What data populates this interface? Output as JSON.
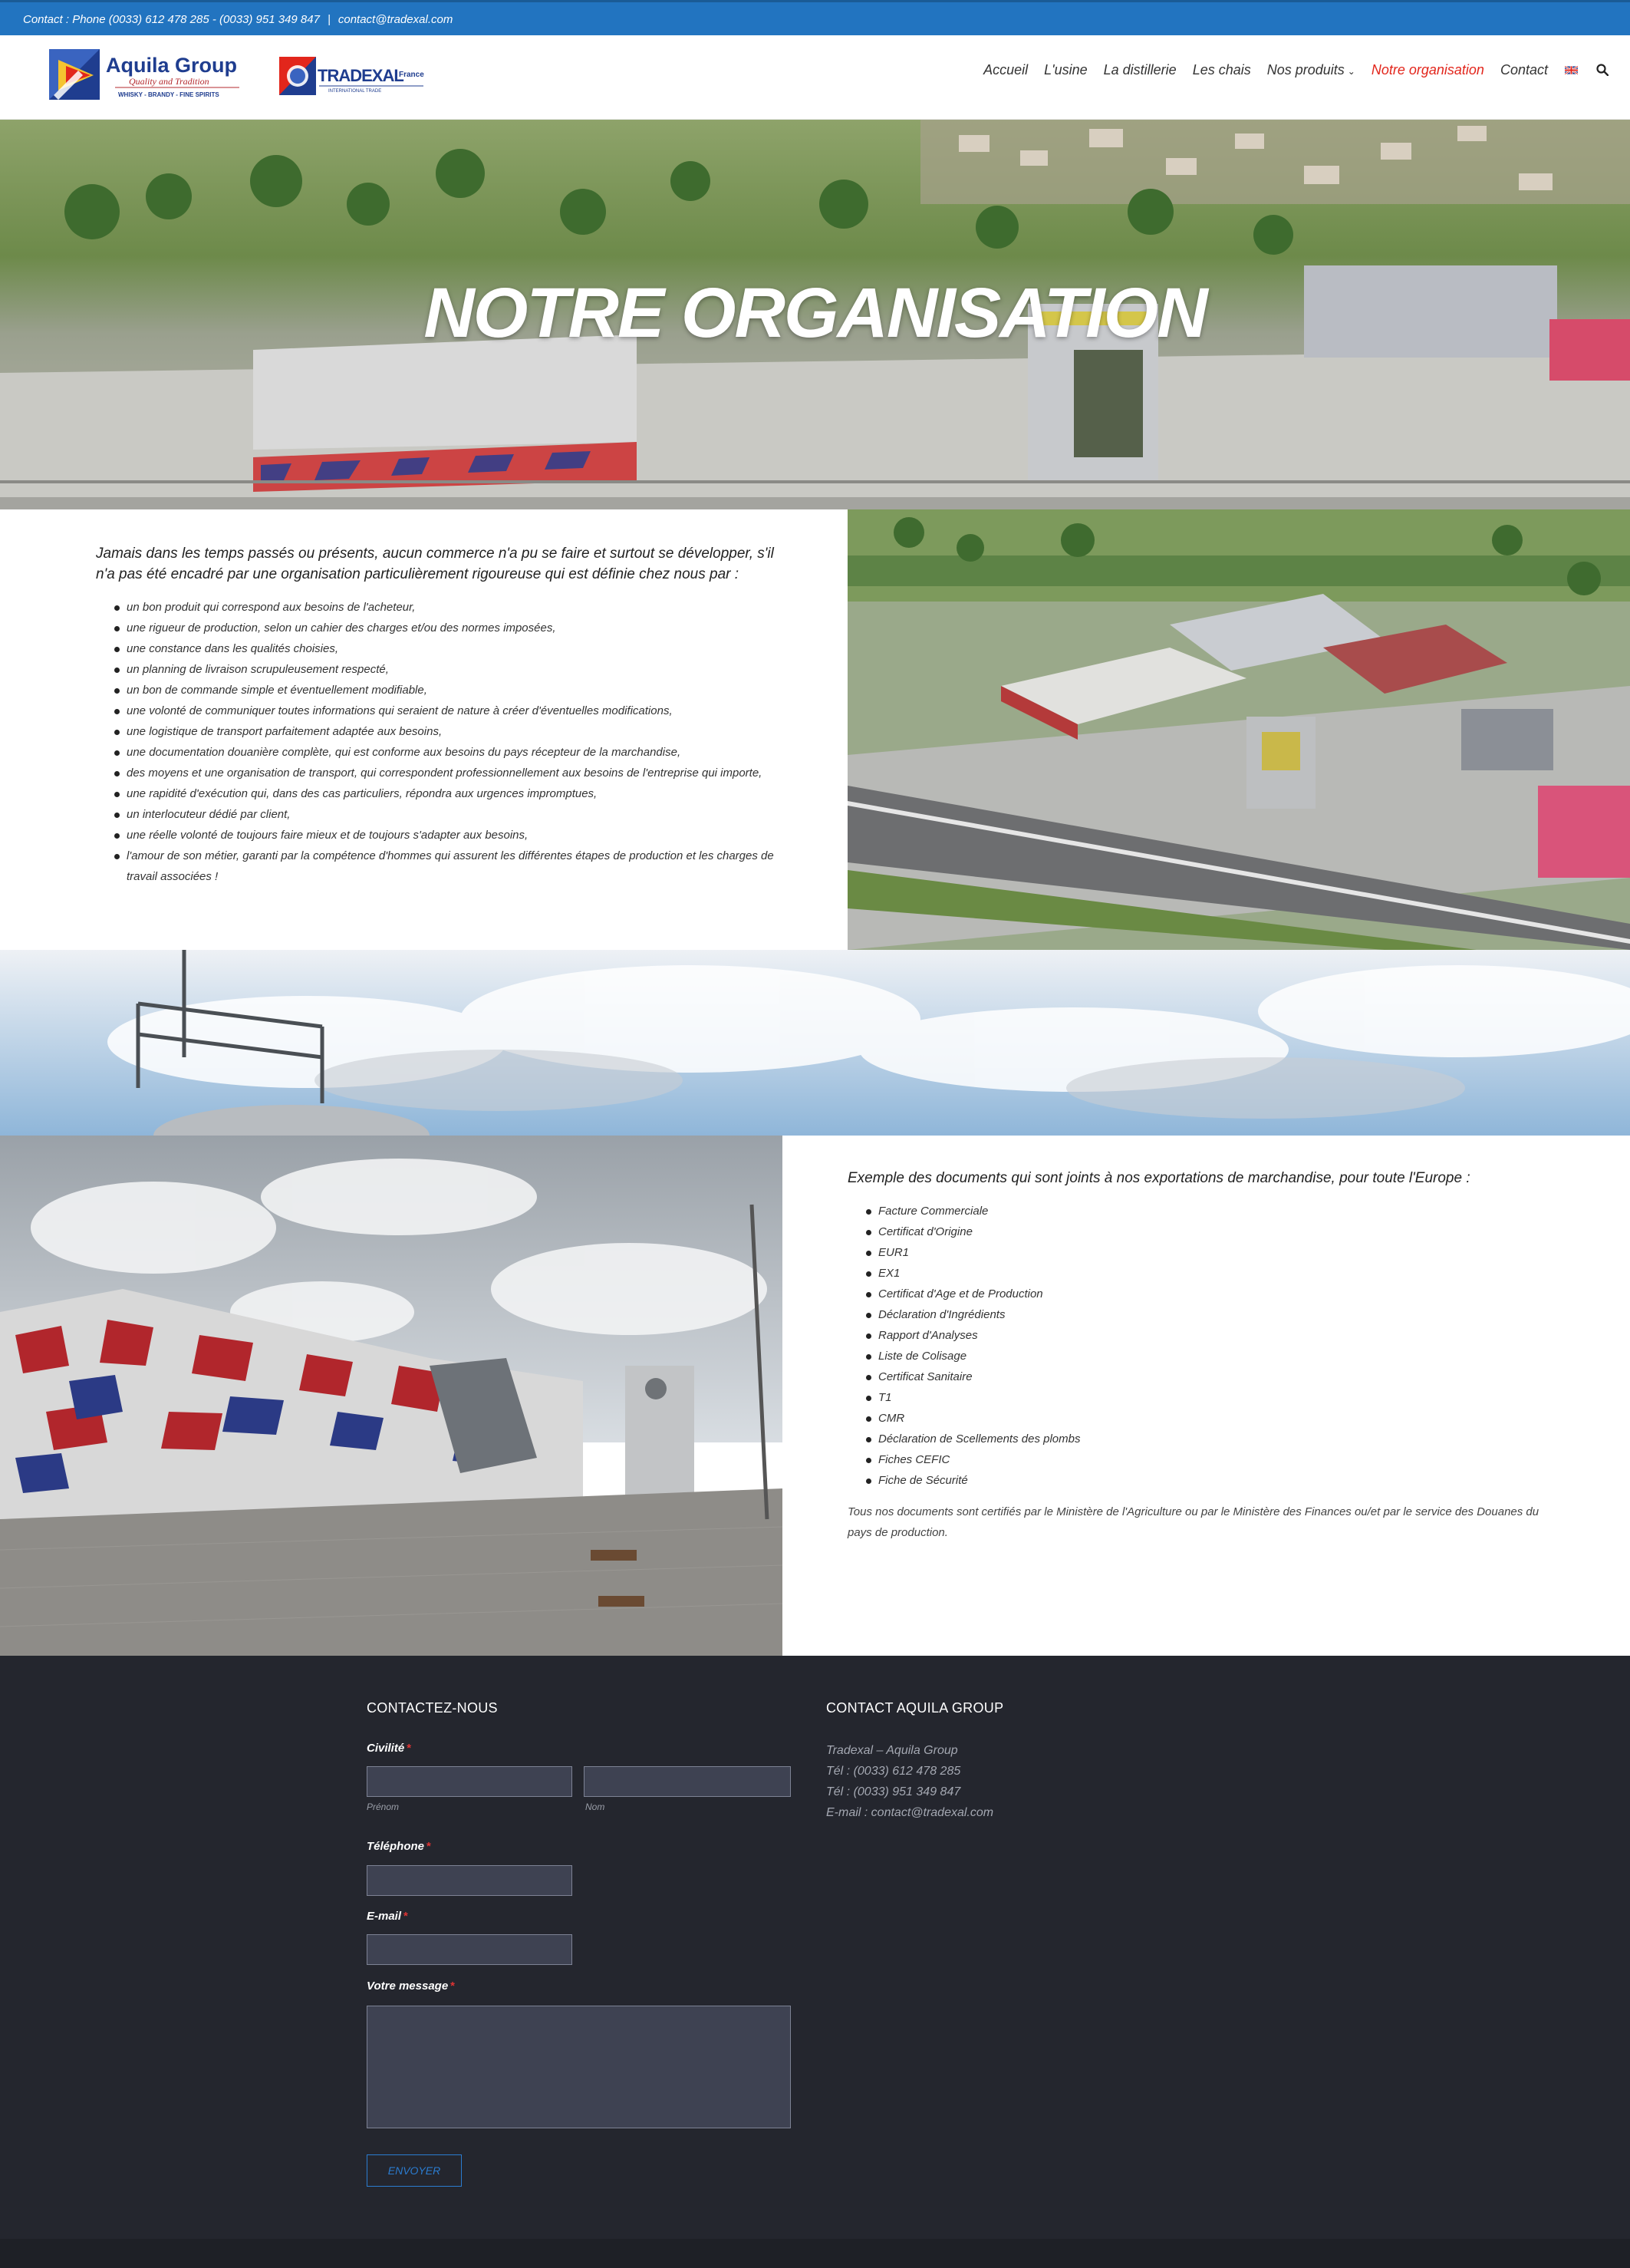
{
  "topbar": {
    "contact_phone": "Contact : Phone (0033) 612 478 285 - (0033) 951 349 847",
    "separator": "|",
    "contact_email": "contact@tradexal.com"
  },
  "header": {
    "logo_aquila": {
      "name": "Aquila Group",
      "tagline": "Quality and Tradition",
      "sub": "WHISKY - BRANDY - FINE SPIRITS"
    },
    "logo_tradexal": {
      "name": "TRADEXAL",
      "country": "France",
      "sub": "INTERNATIONAL TRADE"
    },
    "nav": [
      {
        "label": "Accueil"
      },
      {
        "label": "L'usine"
      },
      {
        "label": "La distillerie"
      },
      {
        "label": "Les chais"
      },
      {
        "label": "Nos produits"
      },
      {
        "label": "Notre organisation"
      },
      {
        "label": "Contact"
      }
    ],
    "flag_icon": "uk-flag-icon",
    "search_icon": "search-icon",
    "active_color": "#e2261c"
  },
  "hero": {
    "title": "NOTRE ORGANISATION"
  },
  "section1": {
    "intro": "Jamais dans les temps passés ou présents, aucun commerce n'a pu se faire et surtout se développer, s'il n'a pas été encadré par une organisation particulièrement rigoureuse qui est définie chez nous par :",
    "items": [
      "un bon produit qui correspond aux besoins de l'acheteur,",
      "une rigueur de production, selon un cahier des charges et/ou des normes imposées,",
      "une constance dans les qualités choisies,",
      "un planning de livraison scrupuleusement respecté,",
      "un bon de commande simple et éventuellement modifiable,",
      "une volonté de communiquer toutes informations qui seraient de nature à créer d'éventuelles modifications,",
      "une logistique de transport parfaitement adaptée aux besoins,",
      "une documentation douanière complète, qui est conforme aux besoins du pays récepteur de la marchandise,",
      "des moyens et une organisation de transport, qui correspondent professionnellement aux besoins de l'entreprise qui importe,",
      "une rapidité d'exécution qui, dans des cas particuliers, répondra aux urgences impromptues,",
      "un interlocuteur dédié par client,",
      "une réelle volonté de toujours faire mieux et de toujours s'adapter aux besoins,",
      "l'amour de son métier, garanti par la compétence d'hommes qui assurent les différentes étapes de production et les charges de travail associées !"
    ]
  },
  "section2": {
    "intro": "Exemple des documents qui sont joints à nos exportations de marchandise, pour toute l'Europe :",
    "items": [
      "Facture Commerciale",
      "Certificat d'Origine",
      "EUR1",
      "EX1",
      "Certificat d'Age et de Production",
      "Déclaration d'Ingrédients",
      "Rapport d'Analyses",
      "Liste de Colisage",
      "Certificat Sanitaire",
      "T1",
      "CMR",
      "Déclaration de Scellements des plombs",
      "Fiches CEFIC",
      "Fiche de Sécurité"
    ],
    "note": "Tous nos documents sont certifiés par le Ministère de l'Agriculture ou par le Ministère des Finances ou/et par le service des Douanes du pays de production."
  },
  "footer": {
    "form_title": "CONTACTEZ-NOUS",
    "civility_label": "Civilité",
    "firstname_sub": "Prénom",
    "lastname_sub": "Nom",
    "phone_label": "Téléphone",
    "email_label": "E-mail",
    "message_label": "Votre message",
    "required_mark": "*",
    "submit_label": "ENVOYER",
    "info_title": "CONTACT AQUILA GROUP",
    "info_lines": [
      "Tradexal – Aquila Group",
      "Tél : (0033) 612 478 285",
      "Tél : (0033) 951 349 847",
      "E-mail : contact@tradexal.com"
    ]
  },
  "colors": {
    "topbar": "#2274c0",
    "footer": "#24262e",
    "accent_red": "#e2261c",
    "button_blue": "#2b7cd0"
  }
}
